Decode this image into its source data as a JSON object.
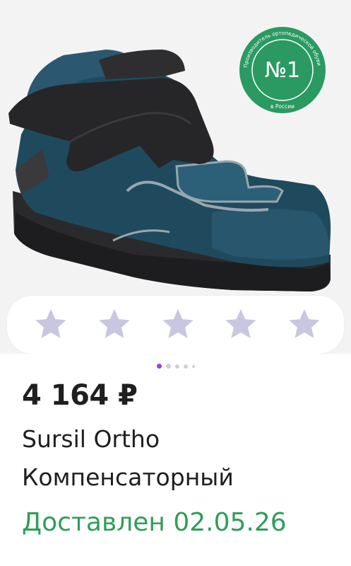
{
  "product": {
    "badge_number": "№1",
    "badge_ring_text": "Производитель ортопедической обуви",
    "badge_bottom_text": "в России",
    "rating": 0,
    "rating_max": 5,
    "image_pages": 5,
    "current_image_page": 1,
    "price": "4 164 ₽",
    "title_line1": "Sursil Ortho",
    "title_line2": "Компенсаторный",
    "delivery": "Доставлен 02.05.26"
  },
  "colors": {
    "image_bg": "#f4f3f3",
    "star_empty": "#c8c6e0",
    "dot_active": "#a33ce6",
    "dot_inactive": "#cfcfd6",
    "delivery_green": "#2f9e58",
    "badge_green": "#2a9a62"
  }
}
